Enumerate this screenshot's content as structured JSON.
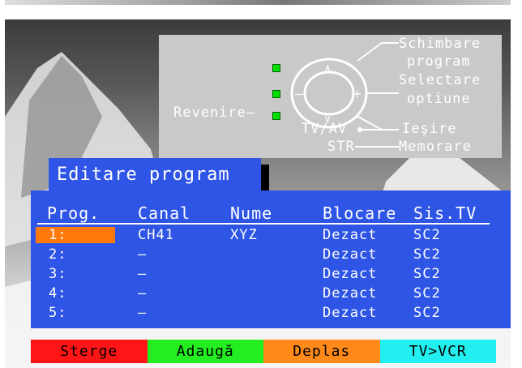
{
  "help": {
    "change_program": "Schimbare",
    "change_program_2": "program",
    "select_option": "Selectare",
    "select_option_2": "optiune",
    "back": "Revenire",
    "exit": "Ieşire",
    "tvav": "TV/AV",
    "str": "STR",
    "store": "Memorare"
  },
  "title": "Editare program",
  "table": {
    "headers": [
      "Prog.",
      "Canal",
      "Nume",
      "Blocare",
      "Sis.TV"
    ],
    "rows": [
      {
        "prog": "1:",
        "canal": "CH41",
        "nume": "XYZ",
        "blocare": "Dezact",
        "sistv": "SC2"
      },
      {
        "prog": "2:",
        "canal": "–",
        "nume": "",
        "blocare": "Dezact",
        "sistv": "SC2"
      },
      {
        "prog": "3:",
        "canal": "–",
        "nume": "",
        "blocare": "Dezact",
        "sistv": "SC2"
      },
      {
        "prog": "4:",
        "canal": "–",
        "nume": "",
        "blocare": "Dezact",
        "sistv": "SC2"
      },
      {
        "prog": "5:",
        "canal": "–",
        "nume": "",
        "blocare": "Dezact",
        "sistv": "SC2"
      }
    ]
  },
  "footer": {
    "red": "Sterge",
    "green": "Adaugă",
    "orange": "Deplas",
    "cyan": "TV>VCR"
  },
  "colors": {
    "panel_blue": "#2e55e6",
    "cursor_orange": "#ff7a0a",
    "red": "#ff1515",
    "green": "#22ee22",
    "cyan": "#22f0f0"
  }
}
